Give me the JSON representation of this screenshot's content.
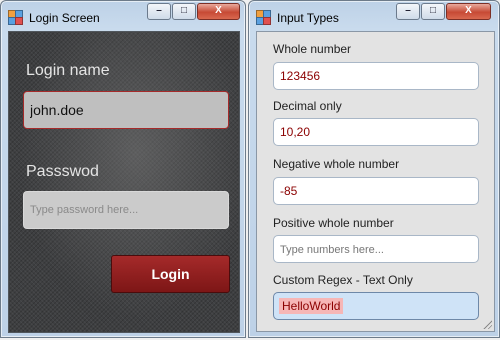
{
  "login_window": {
    "title": "Login Screen",
    "controls": {
      "minimize": "–",
      "maximize": "□",
      "close": "X"
    },
    "login_name_label": "Login name",
    "login_name_value": "john.doe",
    "password_label": "Passswod",
    "password_placeholder": "Type password here...",
    "login_button": "Login"
  },
  "types_window": {
    "title": "Input Types",
    "controls": {
      "minimize": "–",
      "maximize": "□",
      "close": "X"
    },
    "fields": [
      {
        "label": "Whole number",
        "value": "123456",
        "placeholder": ""
      },
      {
        "label": "Decimal only",
        "value": "10,20",
        "placeholder": ""
      },
      {
        "label": "Negative whole number",
        "value": "-85",
        "placeholder": ""
      },
      {
        "label": "Positive whole number",
        "value": "",
        "placeholder": "Type numbers here..."
      },
      {
        "label": "Custom Regex - Text Only",
        "value": "HelloWorld",
        "placeholder": ""
      }
    ]
  },
  "colors": {
    "accent_red": "#8b0000",
    "login_button": "#a52a2a",
    "focus_field": "#cfe3f7"
  }
}
